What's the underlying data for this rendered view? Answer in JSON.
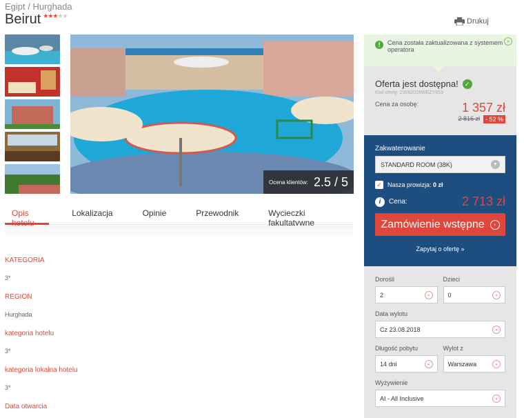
{
  "breadcrumb": "Egipt / Hurghada",
  "hotel": {
    "name": "Beirut",
    "stars": 3,
    "max_stars": 5
  },
  "print_label": "Drukuj",
  "rating": {
    "label": "Ocena klientów:",
    "value": "2.5",
    "max": "/ 5"
  },
  "tabs": [
    "Opis hotelu",
    "Lokalizacja",
    "Opinie",
    "Przewodnik",
    "Wycieczki fakultatywne"
  ],
  "active_tab": 0,
  "attributes": [
    {
      "key": "KATEGORIA",
      "value": "3*"
    },
    {
      "key": "REGION",
      "value": "Hurghada"
    },
    {
      "key": "kategoria hotelu",
      "value": "3*"
    },
    {
      "key": "kategoria lokalna hotelu",
      "value": "3*"
    },
    {
      "key": "Data otwarcia",
      "value": ""
    }
  ],
  "notice": "Cena została zaktualizowana z systemem operatora",
  "offer": {
    "available": "Oferta jest dostępna!",
    "code": "Kod oferty: 23082018WEZY553",
    "price_label": "Cena za osobę:",
    "price": "1 357 zł",
    "old_price": "2 816 zł",
    "discount": "- 52 %"
  },
  "booking": {
    "accommodation_label": "Zakwaterowanie",
    "room": "STANDARD ROOM (38K)",
    "commission_label": "Nasza prowizja:",
    "commission": "0 zł",
    "price_label": "Cena:",
    "total": "2 713 zł",
    "order_button": "Zamówienie wstępne",
    "ask": "Zapytaj o ofertę »"
  },
  "form": {
    "adults_label": "Dorośli",
    "adults": "2",
    "children_label": "Dzieci",
    "children": "0",
    "date_label": "Data wylotu",
    "date": "Cz 23.08.2018",
    "duration_label": "Długość pobytu",
    "duration": "14 dni",
    "departure_label": "Wylot z",
    "departure": "Warszawa",
    "board_label": "Wyżywienie",
    "board": "AI - All Inclusive"
  },
  "colors": {
    "accent": "#e0463a",
    "blue": "#1e4d80",
    "success": "#52a83f"
  }
}
